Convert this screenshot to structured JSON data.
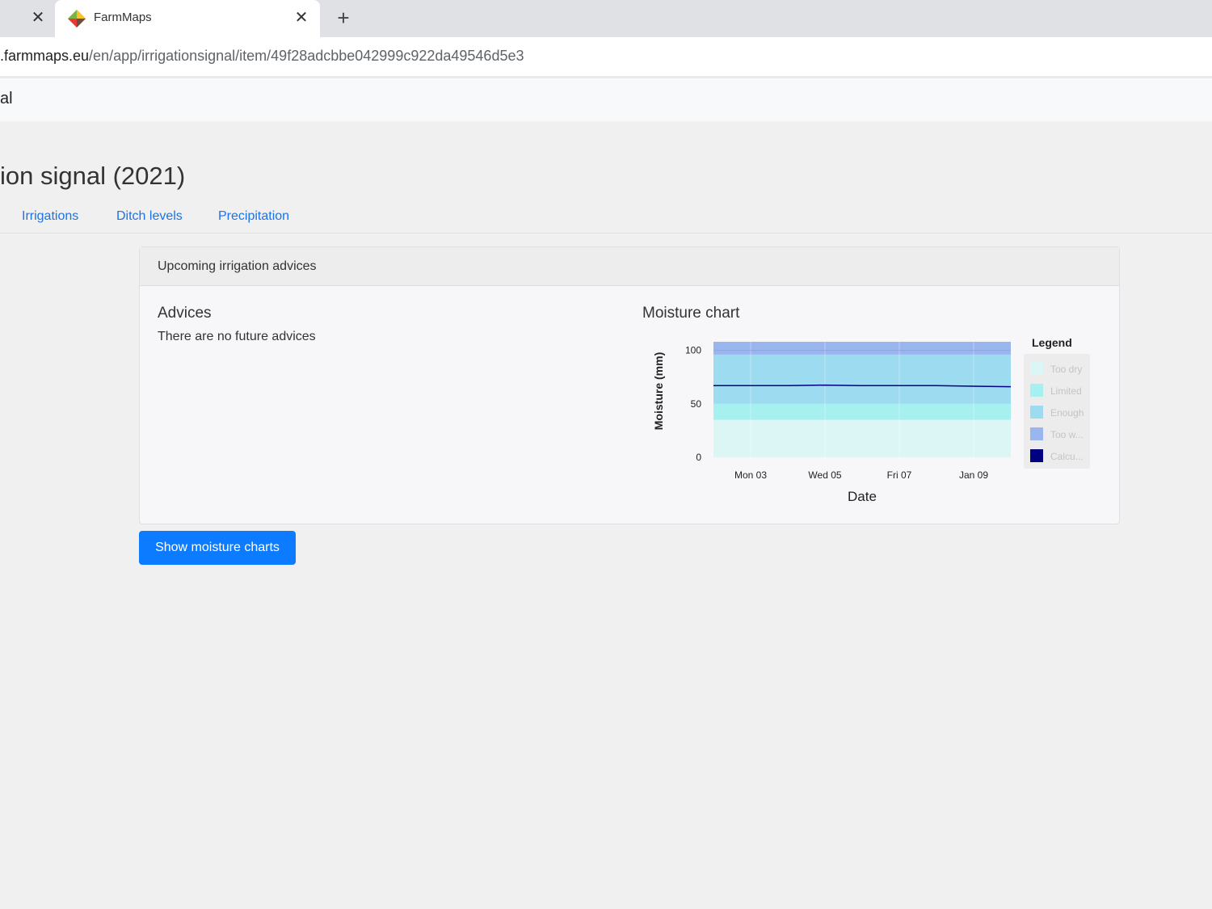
{
  "browser": {
    "active_tab_title": "FarmMaps",
    "url_host": ".farmmaps.eu",
    "url_path": "/en/app/irrigationsignal/item/49f28adcbbe042999c922da49546d5e3"
  },
  "app": {
    "nav_title": "al"
  },
  "page": {
    "title": "ion signal (2021)",
    "tabs": [
      "Irrigations",
      "Ditch levels",
      "Precipitation"
    ]
  },
  "card": {
    "header": "Upcoming irrigation advices",
    "advices_title": "Advices",
    "advices_text": "There are no future advices",
    "chart_title": "Moisture chart"
  },
  "button": {
    "label": "Show moisture charts"
  },
  "colors": {
    "accent_link": "#1a73e8",
    "primary_button": "#0d7bff",
    "too_dry": "#dcf6f6",
    "limited": "#a6f0f0",
    "enough": "#9ddcf0",
    "too_wet": "#9ab6ef",
    "calculated": "#000080"
  },
  "chart_data": {
    "type": "area",
    "xlabel": "Date",
    "ylabel": "Moisture (mm)",
    "ylim": [
      0,
      108
    ],
    "yticks": [
      0,
      50,
      100
    ],
    "xticks": [
      "Mon 03",
      "Wed 05",
      "Fri 07",
      "Jan 09"
    ],
    "x": [
      0,
      1,
      2,
      3,
      4,
      5,
      6,
      7,
      8
    ],
    "legend_title": "Legend",
    "legend_position": "right",
    "bands": [
      {
        "name": "Too dry",
        "label": "Too dry",
        "from": 0,
        "to": 35,
        "color": "#dcf6f6"
      },
      {
        "name": "Limited",
        "label": "Limited",
        "from": 35,
        "to": 50,
        "color": "#a6f0f0"
      },
      {
        "name": "Enough",
        "label": "Enough",
        "from": 50,
        "to": 96,
        "color": "#9ddcf0"
      },
      {
        "name": "Too wet",
        "label": "Too w...",
        "from": 96,
        "to": 108,
        "color": "#9ab6ef"
      }
    ],
    "series": [
      {
        "name": "Calculated",
        "label": "Calcu...",
        "color": "#000080",
        "values": [
          67,
          67,
          67,
          67.5,
          67,
          67,
          67,
          66.5,
          66
        ]
      }
    ]
  }
}
